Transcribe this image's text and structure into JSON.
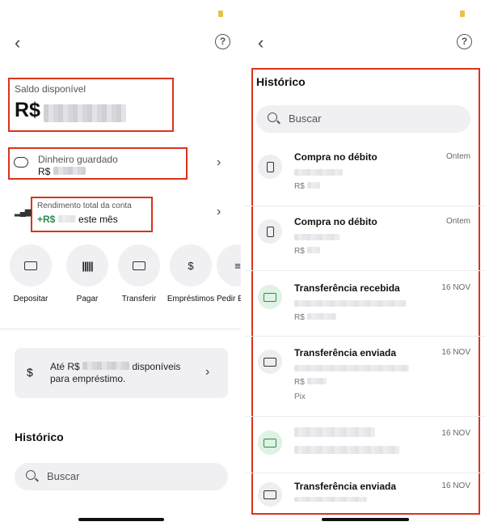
{
  "left": {
    "balance_label": "Saldo disponível",
    "currency": "R$",
    "stored_label": "Dinheiro guardado",
    "stored_currency": "R$",
    "yield_label": "Rendimento total da conta",
    "yield_prefix": "+R$",
    "yield_suffix": "este mês",
    "actions": [
      {
        "label": "Depositar",
        "icon": "deposit-icon"
      },
      {
        "label": "Pagar",
        "icon": "barcode-icon"
      },
      {
        "label": "Transferir",
        "icon": "transfer-icon"
      },
      {
        "label": "Empréstimos",
        "icon": "loan-icon"
      },
      {
        "label": "Pedir E",
        "icon": "document-icon"
      }
    ],
    "loan_text_a": "Até R$",
    "loan_text_b": "disponíveis",
    "loan_text_c": "para empréstimo.",
    "history_title": "Histórico",
    "search_placeholder": "Buscar"
  },
  "right": {
    "history_title": "Histórico",
    "search_placeholder": "Buscar",
    "transactions": [
      {
        "title": "Compra no débito",
        "date": "Ontem",
        "currency": "R$",
        "extra": "",
        "icon": "phone-icon"
      },
      {
        "title": "Compra no débito",
        "date": "Ontem",
        "currency": "R$",
        "extra": "",
        "icon": "phone-icon"
      },
      {
        "title": "Transferência recebida",
        "date": "16 NOV",
        "currency": "R$",
        "extra": "",
        "icon": "money-in-icon"
      },
      {
        "title": "Transferência enviada",
        "date": "16 NOV",
        "currency": "R$",
        "extra": "Pix",
        "icon": "money-out-icon"
      },
      {
        "title": "",
        "date": "16 NOV",
        "currency": "",
        "extra": "",
        "icon": "cash-icon"
      },
      {
        "title": "Transferência enviada",
        "date": "16 NOV",
        "currency": "",
        "extra": "",
        "icon": "money-out-icon"
      }
    ]
  },
  "colors": {
    "highlight": "#d8341e",
    "green": "#2d8a4e",
    "surface": "#f0f0f3"
  }
}
